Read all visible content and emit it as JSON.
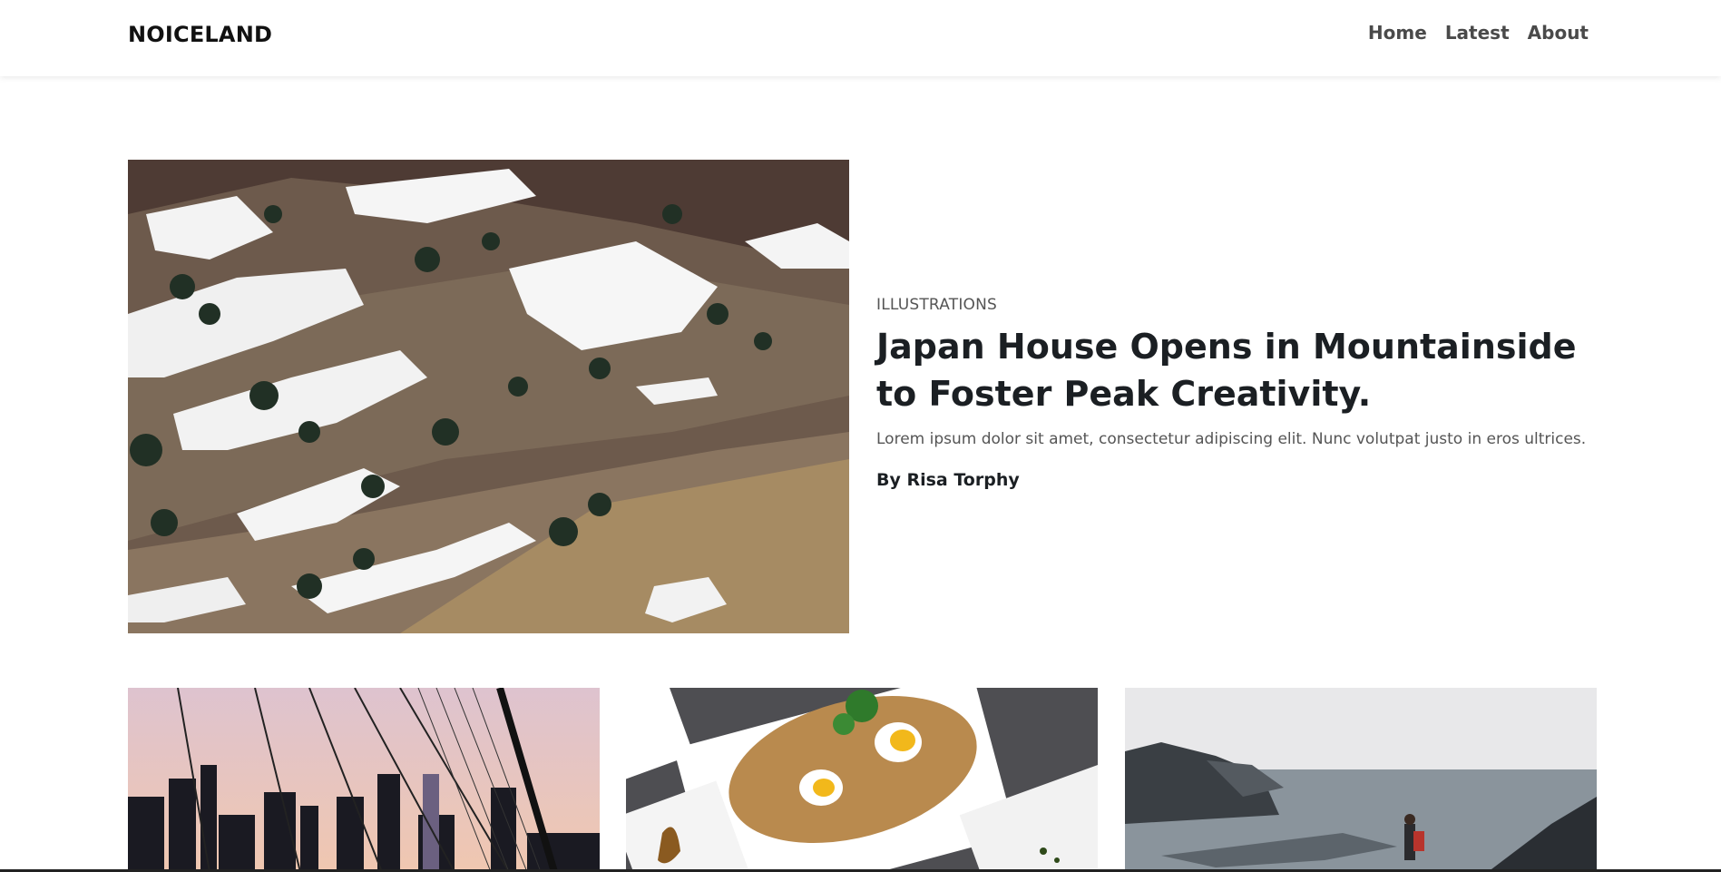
{
  "navbar": {
    "brand": "NOICELAND",
    "links": [
      {
        "label": "Home"
      },
      {
        "label": "Latest"
      },
      {
        "label": "About"
      }
    ]
  },
  "featured": {
    "category": "ILLUSTRATIONS",
    "title": "Japan House Opens in Mountainside to Foster Peak Creativity.",
    "excerpt": "Lorem ipsum dolor sit amet, consectetur adipiscing elit. Nunc volutpat justo in eros ultrices.",
    "byline": "By Risa Torphy"
  },
  "cards": [
    {
      "image": "city-bridge-photo"
    },
    {
      "image": "food-plate-photo"
    },
    {
      "image": "coastal-hiker-photo"
    }
  ],
  "colors": {
    "text_dark": "#1b1f23",
    "text_muted": "#555555",
    "nav_link": "#4a4a4a"
  }
}
